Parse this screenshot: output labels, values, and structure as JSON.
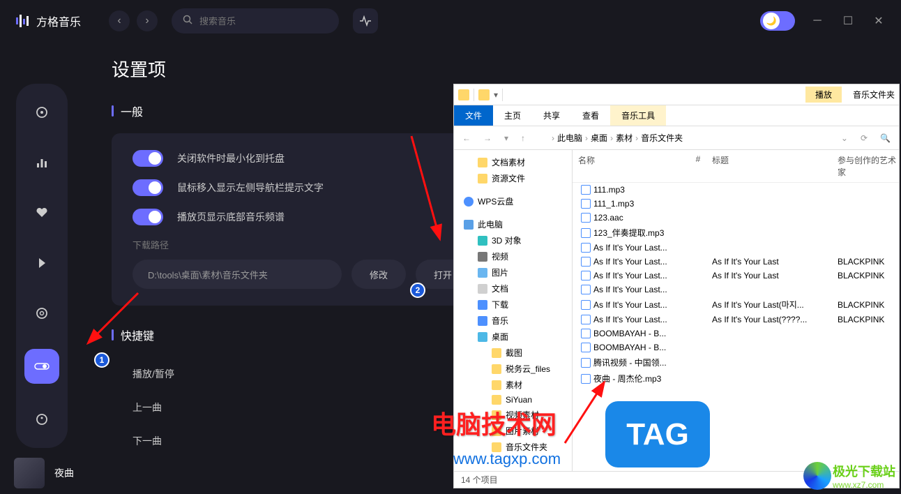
{
  "app": {
    "name": "方格音乐",
    "search_placeholder": "搜索音乐"
  },
  "page": {
    "title": "设置项",
    "general_label": "一般",
    "shortcuts_label": "快捷键",
    "switches": {
      "close_to_tray": "关闭软件时最小化到托盘",
      "hover_sidebar": "鼠标移入显示左侧导航栏提示文字",
      "show_visualizer": "播放页显示底部音乐频谱"
    },
    "download_path_label": "下载路径",
    "download_path": "D:\\tools\\桌面\\素材\\音乐文件夹",
    "modify_btn": "修改",
    "open_btn": "打开",
    "shortcuts": {
      "play_pause": "播放/暂停",
      "prev": "上一曲",
      "next": "下一曲"
    }
  },
  "player": {
    "title": "夜曲"
  },
  "explorer": {
    "title_right": "音乐文件夹",
    "play_tab": "播放",
    "tabs": {
      "file": "文件",
      "home": "主页",
      "share": "共享",
      "view": "查看",
      "music": "音乐工具"
    },
    "breadcrumb": [
      "此电脑",
      "桌面",
      "素材",
      "音乐文件夹"
    ],
    "tree": {
      "docs": "文档素材",
      "res": "资源文件",
      "wps": "WPS云盘",
      "pc": "此电脑",
      "obj3d": "3D 对象",
      "video": "视频",
      "pic": "图片",
      "doc": "文档",
      "dl": "下载",
      "music": "音乐",
      "desk": "桌面",
      "screenshot": "截图",
      "tax": "税务云_files",
      "material": "素材",
      "siyuan": "SiYuan",
      "vidmat": "视频素材",
      "picmat": "图片素材",
      "musfolder": "音乐文件夹"
    },
    "columns": {
      "name": "名称",
      "num": "#",
      "title": "标题",
      "artist": "参与创作的艺术家"
    },
    "files": [
      {
        "name": "111.mp3",
        "title": "",
        "artist": ""
      },
      {
        "name": "111_1.mp3",
        "title": "",
        "artist": ""
      },
      {
        "name": "123.aac",
        "title": "",
        "artist": ""
      },
      {
        "name": "123_伴奏提取.mp3",
        "title": "",
        "artist": ""
      },
      {
        "name": "As If It's Your Last...",
        "title": "",
        "artist": ""
      },
      {
        "name": "As If It's Your Last...",
        "title": "As If It's Your Last",
        "artist": "BLACKPINK"
      },
      {
        "name": "As If It's Your Last...",
        "title": "As If It's Your Last",
        "artist": "BLACKPINK"
      },
      {
        "name": "As If It's Your Last...",
        "title": "",
        "artist": ""
      },
      {
        "name": "As If It's Your Last...",
        "title": "As If It's Your Last(마지...",
        "artist": "BLACKPINK"
      },
      {
        "name": "As If It's Your Last...",
        "title": "As If It's Your Last(????...",
        "artist": "BLACKPINK"
      },
      {
        "name": "BOOMBAYAH - B...",
        "title": "",
        "artist": ""
      },
      {
        "name": "BOOMBAYAH - B...",
        "title": "",
        "artist": ""
      },
      {
        "name": "腾讯视频 - 中国领...",
        "title": "",
        "artist": ""
      },
      {
        "name": "夜曲 - 周杰伦.mp3",
        "title": "",
        "artist": ""
      }
    ],
    "status": "14 个项目"
  },
  "watermark": {
    "red": "电脑技术网",
    "url": "www.tagxp.com",
    "tag": "TAG",
    "dl_text": "极光下载站",
    "dl_url": "www.xz7.com"
  },
  "annotations": {
    "n1": "1",
    "n2": "2"
  }
}
